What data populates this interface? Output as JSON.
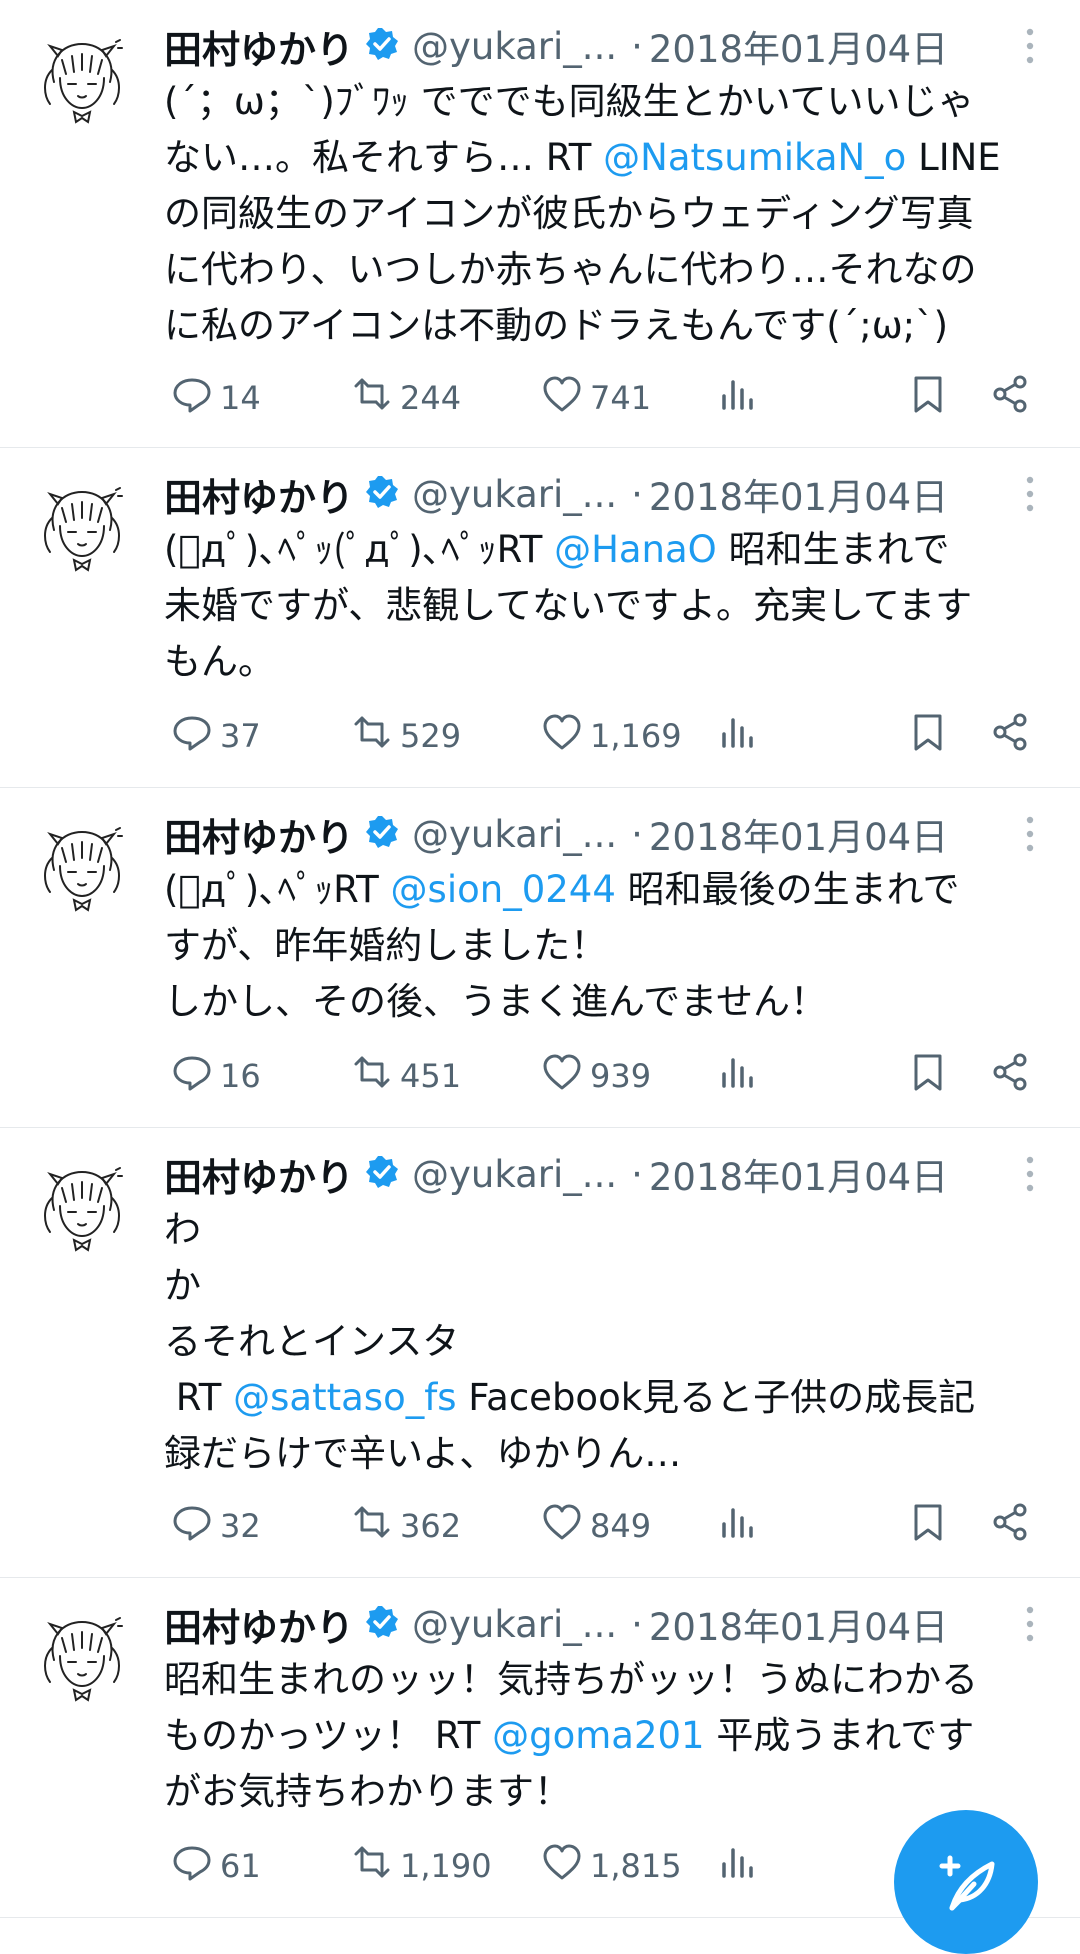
{
  "tweets": [
    {
      "name": "田村ゆかり",
      "handle": "@yukari_...",
      "separator": "·",
      "date": "2018年01月04日",
      "lines": [
        [
          {
            "t": "(´；ω；`)ﾌﾞﾜｯ でででも同級生とかいていいじゃ"
          }
        ],
        [
          {
            "t": "ない…。私それすら… RT "
          },
          {
            "t": "@NatsumikaN_o",
            "m": true
          },
          {
            "t": " LINE"
          }
        ],
        [
          {
            "t": "の同級生のアイコンが彼氏からウェディング写真"
          }
        ],
        [
          {
            "t": "に代わり、いつしか赤ちゃんに代わり…それなの"
          }
        ],
        [
          {
            "t": "に私のアイコンは不動のドラえもんです(´;ω;`)"
          }
        ]
      ],
      "replies": "14",
      "retweets": "244",
      "likes": "741"
    },
    {
      "name": "田村ゆかり",
      "handle": "@yukari_...",
      "separator": "·",
      "date": "2018年01月04日",
      "lines": [
        [
          {
            "t": "(ﾟдﾟ)､ﾍﾟｯ(ﾟдﾟ)､ﾍﾟｯRT "
          },
          {
            "t": "@HanaO",
            "m": true
          },
          {
            "t": " 昭和生まれで"
          }
        ],
        [
          {
            "t": "未婚ですが、悲観してないですよ。充実してます"
          }
        ],
        [
          {
            "t": "もん。"
          }
        ]
      ],
      "replies": "37",
      "retweets": "529",
      "likes": "1,169"
    },
    {
      "name": "田村ゆかり",
      "handle": "@yukari_...",
      "separator": "·",
      "date": "2018年01月04日",
      "lines": [
        [
          {
            "t": "(ﾟдﾟ)､ﾍﾟｯRT "
          },
          {
            "t": "@sion_0244",
            "m": true
          },
          {
            "t": " 昭和最後の生まれで"
          }
        ],
        [
          {
            "t": "すが、昨年婚約しました！"
          }
        ],
        [
          {
            "t": "しかし、その後、うまく進んでません！"
          }
        ]
      ],
      "replies": "16",
      "retweets": "451",
      "likes": "939"
    },
    {
      "name": "田村ゆかり",
      "handle": "@yukari_...",
      "separator": "·",
      "date": "2018年01月04日",
      "lines": [
        [
          {
            "t": "わ"
          }
        ],
        [
          {
            "t": "か"
          }
        ],
        [
          {
            "t": "るそれとインスタ"
          }
        ],
        [
          {
            "t": " RT "
          },
          {
            "t": "@sattaso_fs",
            "m": true
          },
          {
            "t": " Facebook見ると子供の成長記"
          }
        ],
        [
          {
            "t": "録だらけで辛いよ、ゆかりん…"
          }
        ]
      ],
      "replies": "32",
      "retweets": "362",
      "likes": "849"
    },
    {
      "name": "田村ゆかり",
      "handle": "@yukari_...",
      "separator": "·",
      "date": "2018年01月04日",
      "lines": [
        [
          {
            "t": "昭和生まれのッッ！気持ちがッッ！うぬにわかる"
          }
        ],
        [
          {
            "t": "ものかっツッ！ RT "
          },
          {
            "t": "@goma201",
            "m": true
          },
          {
            "t": " 平成うまれです"
          }
        ],
        [
          {
            "t": "がお気持ちわかります！"
          }
        ]
      ],
      "replies": "61",
      "retweets": "1,190",
      "likes": "1,815"
    }
  ],
  "colors": {
    "accent": "#1d9bf0",
    "muted": "#536471",
    "text": "#0f1419"
  },
  "icons": [
    "verified-badge-icon",
    "more-vertical-icon",
    "reply-icon",
    "retweet-icon",
    "like-icon",
    "views-icon",
    "bookmark-icon",
    "share-icon",
    "compose-icon"
  ]
}
